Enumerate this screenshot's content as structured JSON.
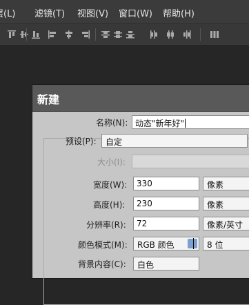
{
  "menubar": {
    "items": [
      {
        "label": "层(L)"
      },
      {
        "label": "滤镜(T)"
      },
      {
        "label": "视图(V)"
      },
      {
        "label": "窗口(W)"
      },
      {
        "label": "帮助(H)"
      }
    ]
  },
  "toolbar": {
    "icons": [
      "align-top-icon",
      "align-vcenter-icon",
      "align-bottom-icon",
      "align-left-icon",
      "align-hcenter-icon",
      "align-right-icon",
      "distribute-top-icon",
      "distribute-vcenter-icon",
      "distribute-bottom-icon",
      "distribute-left-icon",
      "distribute-hcenter-icon",
      "distribute-right-icon",
      "auto-align-icon"
    ]
  },
  "dialog": {
    "title": "新建",
    "name_label": "名称(N):",
    "name_value": "动态\"新年好\"",
    "preset_label": "预设(P):",
    "preset_value": "自定",
    "size_label": "大小(I):",
    "width_label": "宽度(W):",
    "width_value": "330",
    "width_unit": "像素",
    "height_label": "高度(H):",
    "height_value": "230",
    "height_unit": "像素",
    "resolution_label": "分辨率(R):",
    "resolution_value": "72",
    "resolution_unit": "像素/英寸",
    "color_mode_label": "颜色模式(M):",
    "color_mode_value": "RGB 颜色",
    "bit_depth_value": "8 位",
    "background_label": "背景内容(C):",
    "background_value": "白色"
  }
}
